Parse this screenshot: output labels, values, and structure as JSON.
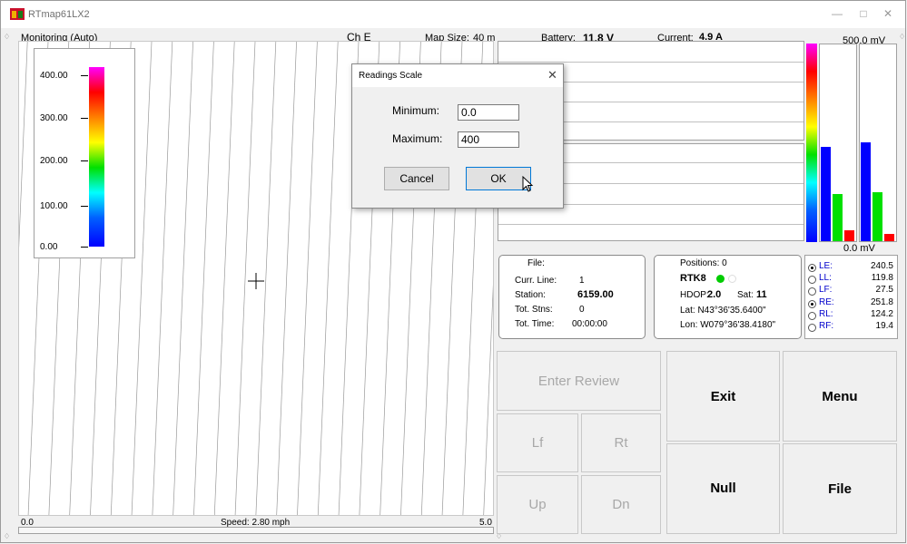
{
  "window": {
    "title": "RTmap61LX2"
  },
  "header": {
    "mode": "Monitoring (Auto)",
    "channel": "Ch E",
    "map_size_label": "Map Size:",
    "map_size_value": "40 m",
    "battery_label": "Battery:",
    "battery_value": "11.8 V",
    "current_label": "Current:",
    "current_value": "4.9 A",
    "mv_top": "500.0 mV",
    "mv_bottom": "0.0 mV"
  },
  "legend": {
    "labels": [
      "400.00",
      "300.00",
      "200.00",
      "100.00",
      "0.00"
    ]
  },
  "map": {
    "scale_min": "0.0",
    "scale_max": "5.0",
    "speed": "Speed:  2.80 mph"
  },
  "file_info": {
    "file_label": "File:",
    "curr_line_label": "Curr. Line:",
    "curr_line_value": "1",
    "station_label": "Station:",
    "station_value": "6159.00",
    "tot_stns_label": "Tot. Stns:",
    "tot_stns_value": "0",
    "tot_time_label": "Tot. Time:",
    "tot_time_value": "00:00:00"
  },
  "gps": {
    "positions": "Positions: 0",
    "mode": "RTK8",
    "hdop_label": "HDOP:",
    "hdop_value": "2.0",
    "sat_label": "Sat:",
    "sat_value": "11",
    "lat": "Lat:  N43°36'35.6400\"",
    "lon": "Lon: W079°36'38.4180\"",
    "status_color": "#00cc00"
  },
  "readings": [
    {
      "label": "LE:",
      "value": "240.5",
      "selected": true
    },
    {
      "label": "LL:",
      "value": "119.8",
      "selected": false
    },
    {
      "label": "LF:",
      "value": "27.5",
      "selected": false
    },
    {
      "label": "RE:",
      "value": "251.8",
      "selected": true
    },
    {
      "label": "RL:",
      "value": "124.2",
      "selected": false
    },
    {
      "label": "RF:",
      "value": "19.4",
      "selected": false
    }
  ],
  "bars": {
    "max_mv": 500,
    "left": [
      {
        "color": "#0000ff",
        "value": 240.5
      },
      {
        "color": "#00e000",
        "value": 119.8
      },
      {
        "color": "#ff0000",
        "value": 27.5
      }
    ],
    "right": [
      {
        "color": "#0000ff",
        "value": 251.8
      },
      {
        "color": "#00e000",
        "value": 124.2
      },
      {
        "color": "#ff0000",
        "value": 19.4
      }
    ]
  },
  "buttons": {
    "enter_review": "Enter Review",
    "exit": "Exit",
    "menu": "Menu",
    "lf": "Lf",
    "rt": "Rt",
    "null": "Null",
    "file": "File",
    "up": "Up",
    "dn": "Dn"
  },
  "dialog": {
    "title": "Readings Scale",
    "min_label": "Minimum:",
    "min_value": "0.0",
    "max_label": "Maximum:",
    "max_value": "400",
    "cancel": "Cancel",
    "ok": "OK"
  }
}
